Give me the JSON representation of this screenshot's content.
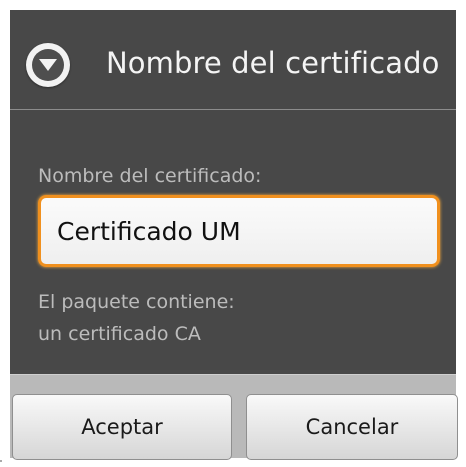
{
  "dialog": {
    "title": "Nombre del certificado",
    "title_icon": "chevron-down-circle-icon",
    "field_label": "Nombre del certificado:",
    "field_value": "Certificado UM",
    "info_line_1": "El paquete contiene:",
    "info_line_2": "un certificado CA",
    "accept_label": "Aceptar",
    "cancel_label": "Cancelar"
  },
  "colors": {
    "dialog_background": "#484848",
    "field_focus_border": "#f0901e",
    "button_bar_background": "#b9b9b9"
  }
}
